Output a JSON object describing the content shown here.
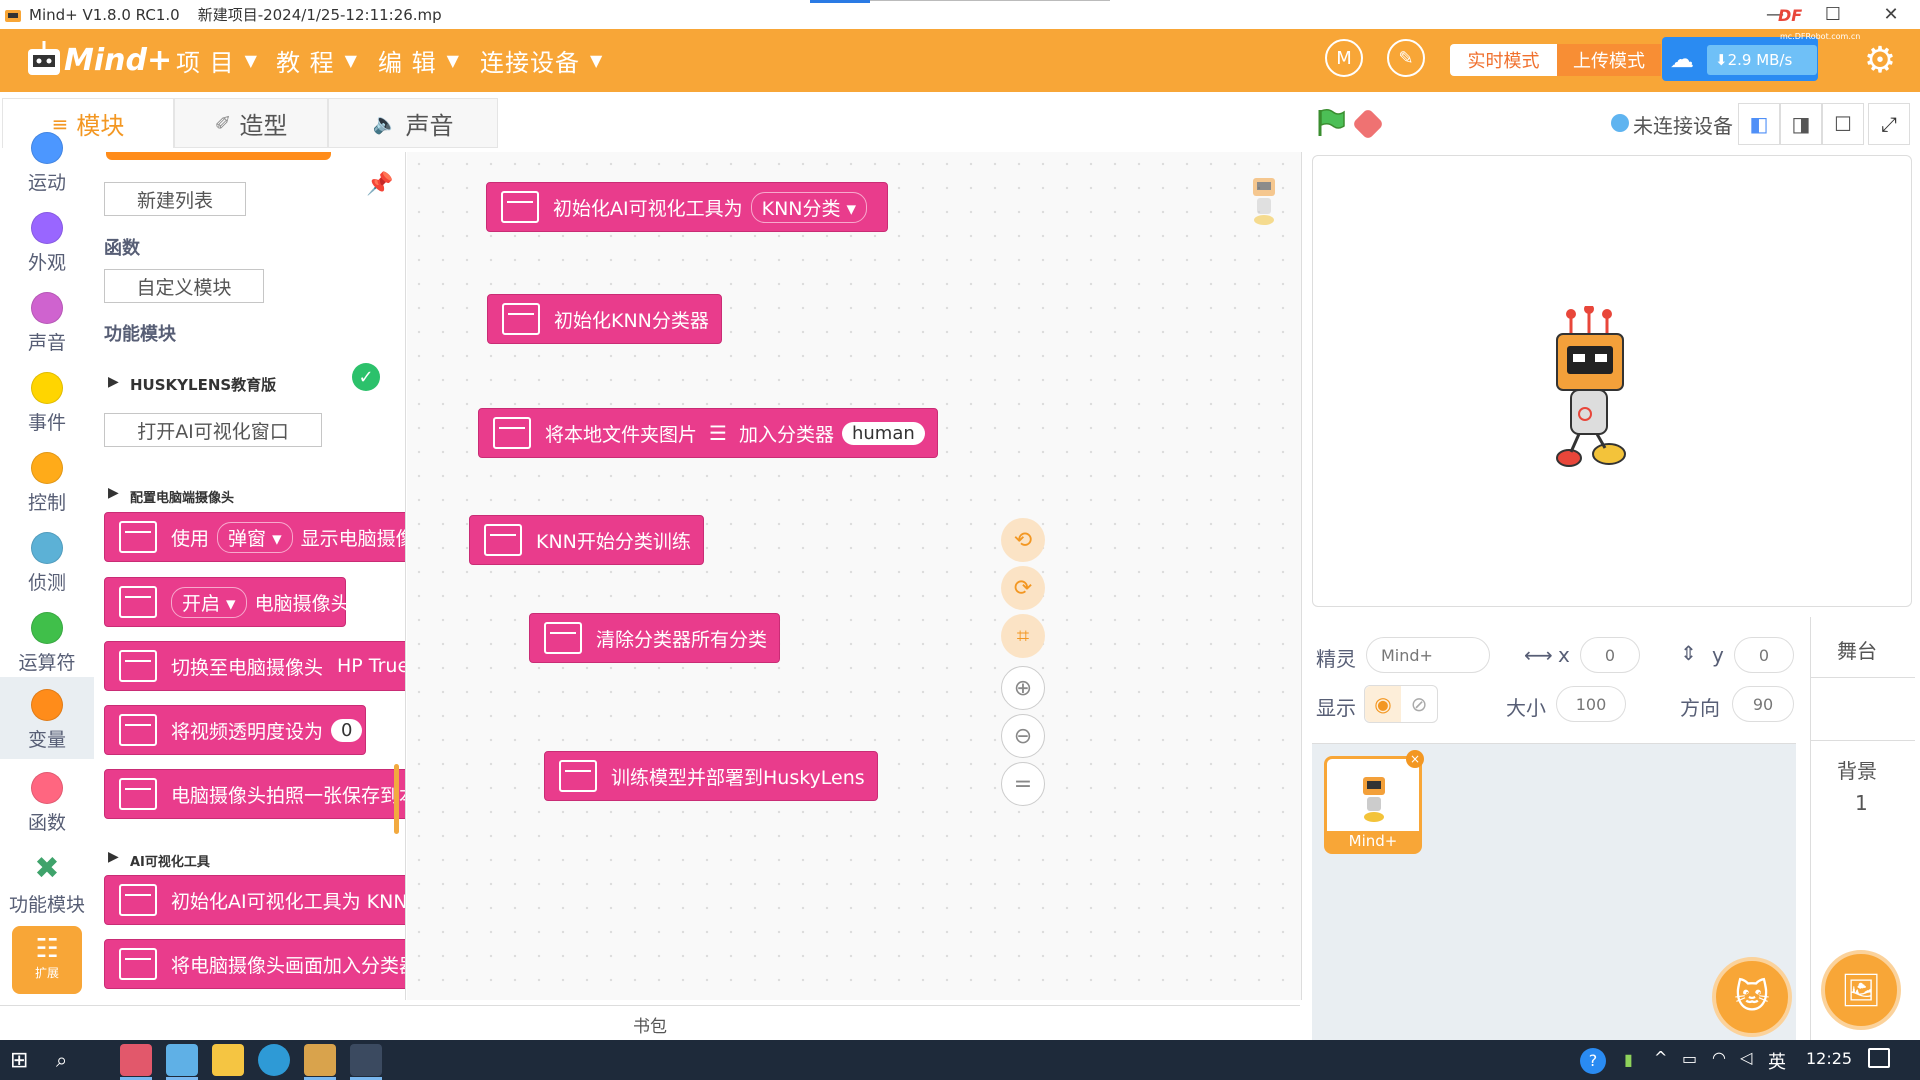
{
  "window": {
    "title": "Mind+ V1.8.0 RC1.0",
    "subtitle": "新建项目-2024/1/25-12:11:26.mp",
    "controls": [
      "—",
      "☐",
      "✕"
    ]
  },
  "menubar": {
    "logo": "Mind+",
    "items": [
      "项 目",
      "教 程",
      "编 辑",
      "连接设备"
    ],
    "mode_realtime": "实时模式",
    "mode_upload": "上传模式",
    "net_speed": "⬇2.9 MB/s",
    "brand_small": "DF",
    "brand_url": "mc.DFRobot.com.cn",
    "accent_color": "#f8a637"
  },
  "tabs": [
    {
      "label": "模块",
      "icon": "blocks-icon"
    },
    {
      "label": "造型",
      "icon": "brush-icon"
    },
    {
      "label": "声音",
      "icon": "speaker-icon"
    }
  ],
  "categories": [
    {
      "label": "运动",
      "color": "#4c97ff"
    },
    {
      "label": "外观",
      "color": "#9966ff"
    },
    {
      "label": "声音",
      "color": "#cf63cf"
    },
    {
      "label": "事件",
      "color": "#ffd500"
    },
    {
      "label": "控制",
      "color": "#ffab19"
    },
    {
      "label": "侦测",
      "color": "#5cb1d6"
    },
    {
      "label": "运算符",
      "color": "#40bf4a"
    },
    {
      "label": "变量",
      "color": "#ff8c1a"
    },
    {
      "label": "函数",
      "color": "#ff6680"
    },
    {
      "label": "功能模块",
      "color": "#4fc3a1"
    }
  ],
  "extension_label": "扩展",
  "flyout": {
    "new_list": "新建列表",
    "functions_head": "函数",
    "custom_block": "自定义模块",
    "func_modules_head": "功能模块",
    "huskylens": "HUSKYLENS教育版",
    "open_ai_window": "打开AI可视化窗口",
    "camera_section": "配置电脑端摄像头",
    "camera_blocks": [
      {
        "pre": "使用",
        "dd": "弹窗",
        "post": "显示电脑摄像头"
      },
      {
        "pre": "",
        "dd": "开启",
        "post": "电脑摄像头"
      },
      {
        "pre": "切换至电脑摄像头",
        "dd": "",
        "post": "HP TrueVision"
      },
      {
        "pre": "将视频透明度设为",
        "dd": "",
        "post": "",
        "pill": "0"
      },
      {
        "pre": "电脑摄像头拍照一张保存到本地",
        "dd": "",
        "post": ""
      }
    ],
    "ai_section": "AI可视化工具",
    "ai_blocks": [
      "初始化AI可视化工具为 KNN",
      "将电脑摄像头画面加入分类器"
    ]
  },
  "workspace_blocks": [
    {
      "text": "初始化AI可视化工具为",
      "dd": "KNN分类 ▾"
    },
    {
      "text": "初始化KNN分类器"
    },
    {
      "text": "将本地文件夹图片",
      "icon": "☰",
      "text2": "加入分类器",
      "pill": "human"
    },
    {
      "text": "KNN开始分类训练"
    },
    {
      "text": "清除分类器所有分类"
    },
    {
      "text": "训练模型并部署到HuskyLens"
    }
  ],
  "backpack": "书包",
  "stage_header": {
    "connect_status": "未连接设备"
  },
  "sprite": {
    "label": "精灵",
    "name": "Mind+",
    "x_label": "x",
    "x": "0",
    "y_label": "y",
    "y": "0",
    "show_label": "显示",
    "size_label": "大小",
    "size": "100",
    "dir_label": "方向",
    "direction": "90",
    "thumb_name": "Mind+"
  },
  "stage_panel": {
    "label": "舞台",
    "backdrop_label": "背景",
    "backdrop_count": "1"
  },
  "taskbar": {
    "ime": "英",
    "time": "12:25"
  }
}
